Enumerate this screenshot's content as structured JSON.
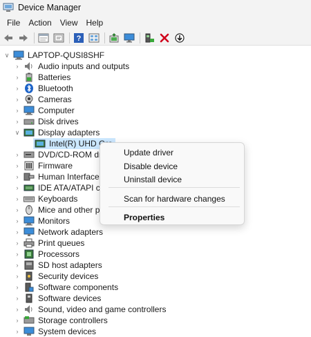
{
  "window": {
    "title": "Device Manager"
  },
  "menu": {
    "file": "File",
    "action": "Action",
    "view": "View",
    "help": "Help"
  },
  "toolbar": {
    "buttons": [
      "back-icon",
      "forward-icon",
      "properties-icon",
      "show-hidden-icon",
      "help-icon",
      "device-grid-icon",
      "update-driver-icon",
      "scan-monitor-icon",
      "add-device-icon",
      "uninstall-icon",
      "download-icon"
    ]
  },
  "tree": {
    "root": "LAPTOP-QUSI8SHF",
    "categories": [
      {
        "label": "Audio inputs and outputs",
        "icon": "speaker-icon"
      },
      {
        "label": "Batteries",
        "icon": "battery-icon"
      },
      {
        "label": "Bluetooth",
        "icon": "bluetooth-icon"
      },
      {
        "label": "Cameras",
        "icon": "camera-icon"
      },
      {
        "label": "Computer",
        "icon": "computer-icon"
      },
      {
        "label": "Disk drives",
        "icon": "disk-icon"
      },
      {
        "label": "Display adapters",
        "icon": "display-adapter-icon",
        "expanded": true
      },
      {
        "label": "DVD/CD-ROM drive",
        "icon": "dvd-icon"
      },
      {
        "label": "Firmware",
        "icon": "firmware-icon"
      },
      {
        "label": "Human Interface De",
        "icon": "hid-icon"
      },
      {
        "label": "IDE ATA/ATAPI contro",
        "icon": "ide-icon"
      },
      {
        "label": "Keyboards",
        "icon": "keyboard-icon"
      },
      {
        "label": "Mice and other poin",
        "icon": "mouse-icon"
      },
      {
        "label": "Monitors",
        "icon": "monitor-icon"
      },
      {
        "label": "Network adapters",
        "icon": "network-icon"
      },
      {
        "label": "Print queues",
        "icon": "printer-icon"
      },
      {
        "label": "Processors",
        "icon": "processor-icon"
      },
      {
        "label": "SD host adapters",
        "icon": "sd-card-icon"
      },
      {
        "label": "Security devices",
        "icon": "security-icon"
      },
      {
        "label": "Software components",
        "icon": "software-component-icon"
      },
      {
        "label": "Software devices",
        "icon": "software-device-icon"
      },
      {
        "label": "Sound, video and game controllers",
        "icon": "sound-icon"
      },
      {
        "label": "Storage controllers",
        "icon": "storage-icon"
      },
      {
        "label": "System devices",
        "icon": "system-icon"
      }
    ],
    "child_device": "Intel(R) UHD Gra"
  },
  "context_menu": {
    "update_driver": "Update driver",
    "disable_device": "Disable device",
    "uninstall_device": "Uninstall device",
    "scan_hardware": "Scan for hardware changes",
    "properties": "Properties"
  },
  "colors": {
    "selection": "#cce8ff",
    "chrome": "#f3f3f3",
    "accent_blue": "#0a64c8",
    "red_x": "#d0021b"
  }
}
